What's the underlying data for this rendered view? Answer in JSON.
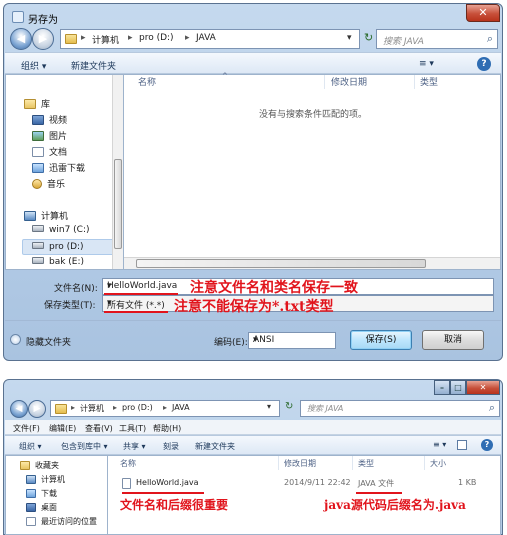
{
  "save_dialog": {
    "title": "另存为",
    "close_glyph": "✕",
    "back_glyph": "◀",
    "forward_glyph": "▶",
    "address": {
      "root_sep": "▸",
      "parts": [
        "计算机",
        "pro (D:)",
        "JAVA"
      ],
      "sep": "▸"
    },
    "refresh_glyph": "↻",
    "search_placeholder": "搜索 JAVA",
    "toolbar": {
      "organize": "组织 ▾",
      "new_folder": "新建文件夹",
      "views": "≡ ▾",
      "help": "?"
    },
    "nav": {
      "libraries": "库",
      "library_items": [
        "视频",
        "图片",
        "文档",
        "迅雷下载",
        "音乐"
      ],
      "computer": "计算机",
      "drives": [
        "win7 (C:)",
        "pro (D:)",
        "bak (E:)"
      ]
    },
    "columns": {
      "name": "名称",
      "modified": "修改日期",
      "type": "类型"
    },
    "empty_message": "没有与搜索条件匹配的项。",
    "filename": {
      "label": "文件名(N):",
      "value": "HelloWorld.java"
    },
    "filetype": {
      "label": "保存类型(T):",
      "value": "所有文件 (*.*)"
    },
    "encoding": {
      "label": "编码(E):",
      "value": "ANSI"
    },
    "hide_folders": "隐藏文件夹",
    "save_button": "保存(S)",
    "cancel_button": "取消",
    "annotation_name": "注意文件名和类名保存一致",
    "annotation_type": "注意不能保存为*.txt类型",
    "accent_red": "#e1141c"
  },
  "explorer": {
    "address": {
      "parts": [
        "计算机",
        "pro (D:)",
        "JAVA"
      ],
      "sep": "▸"
    },
    "search_placeholder": "搜索 JAVA",
    "menu": [
      "文件(F)",
      "编辑(E)",
      "查看(V)",
      "工具(T)",
      "帮助(H)"
    ],
    "toolbar": [
      "组织 ▾",
      "包含到库中 ▾",
      "共享 ▾",
      "刻录",
      "新建文件夹"
    ],
    "nav": [
      "收藏夹",
      "计算机",
      "下载",
      "桌面",
      "最近访问的位置"
    ],
    "columns": {
      "name": "名称",
      "modified": "修改日期",
      "type": "类型",
      "size": "大小"
    },
    "file": {
      "name": "HelloWorld.java",
      "modified": "2014/9/11 22:42",
      "type": "JAVA 文件",
      "size": "1 KB"
    },
    "annotation_left": "文件名和后缀很重要",
    "annotation_right": "java源代码后缀名为.java"
  }
}
